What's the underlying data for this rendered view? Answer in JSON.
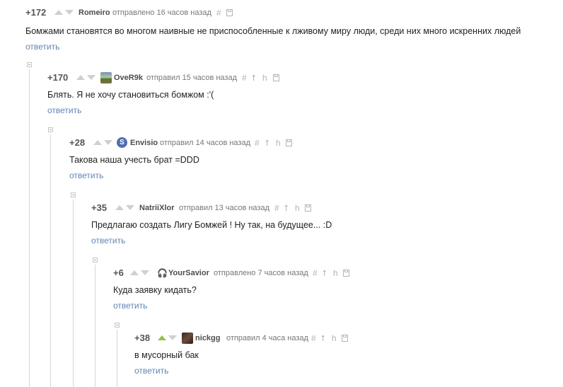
{
  "comments": [
    {
      "rating": "+172",
      "author": "Romeiro",
      "meta": "отправлено 16 часов назад",
      "text": "Бомжами становятся во многом наивные не приспособленные к лживому миру люди, среди них много искренних людей",
      "reply": "ответить",
      "voted": false,
      "avatar": "none"
    },
    {
      "rating": "+170",
      "author": "OveR9k",
      "meta": "отправил 15 часов назад",
      "text": "Блять. Я не хочу становиться бомжом :'(",
      "reply": "ответить",
      "voted": false,
      "avatar": "landscape"
    },
    {
      "rating": "+28",
      "author": "Envisio",
      "meta": "отправил 14 часов назад",
      "text": "Такова наша учесть брат =DDD",
      "reply": "ответить",
      "voted": false,
      "avatar": "letter",
      "avatar_letter": "S"
    },
    {
      "rating": "+35",
      "author": "NatriiXlor",
      "meta": "отправил 13 часов назад",
      "text": "Предлагаю создать Лигу Бомжей ! Ну так, на будущее... :D",
      "reply": "ответить",
      "voted": false,
      "avatar": "none"
    },
    {
      "rating": "+6",
      "author": "YourSavior",
      "meta": "отправлено 7 часов назад",
      "text": "Куда заявку кидать?",
      "reply": "ответить",
      "voted": false,
      "avatar": "headphones"
    },
    {
      "rating": "+38",
      "author": "nickgg",
      "meta": "отправил 4 часа назад",
      "text": "в мусорный бак",
      "reply": "ответить",
      "voted": true,
      "avatar": "photo"
    }
  ],
  "icons": {
    "hash": "#",
    "up": "⭡",
    "tree": "h"
  },
  "colors": {
    "upvoted": "#8cc63f",
    "reply_link": "#5f86b5",
    "avatar_letter_bg": "#4f6eb0"
  }
}
